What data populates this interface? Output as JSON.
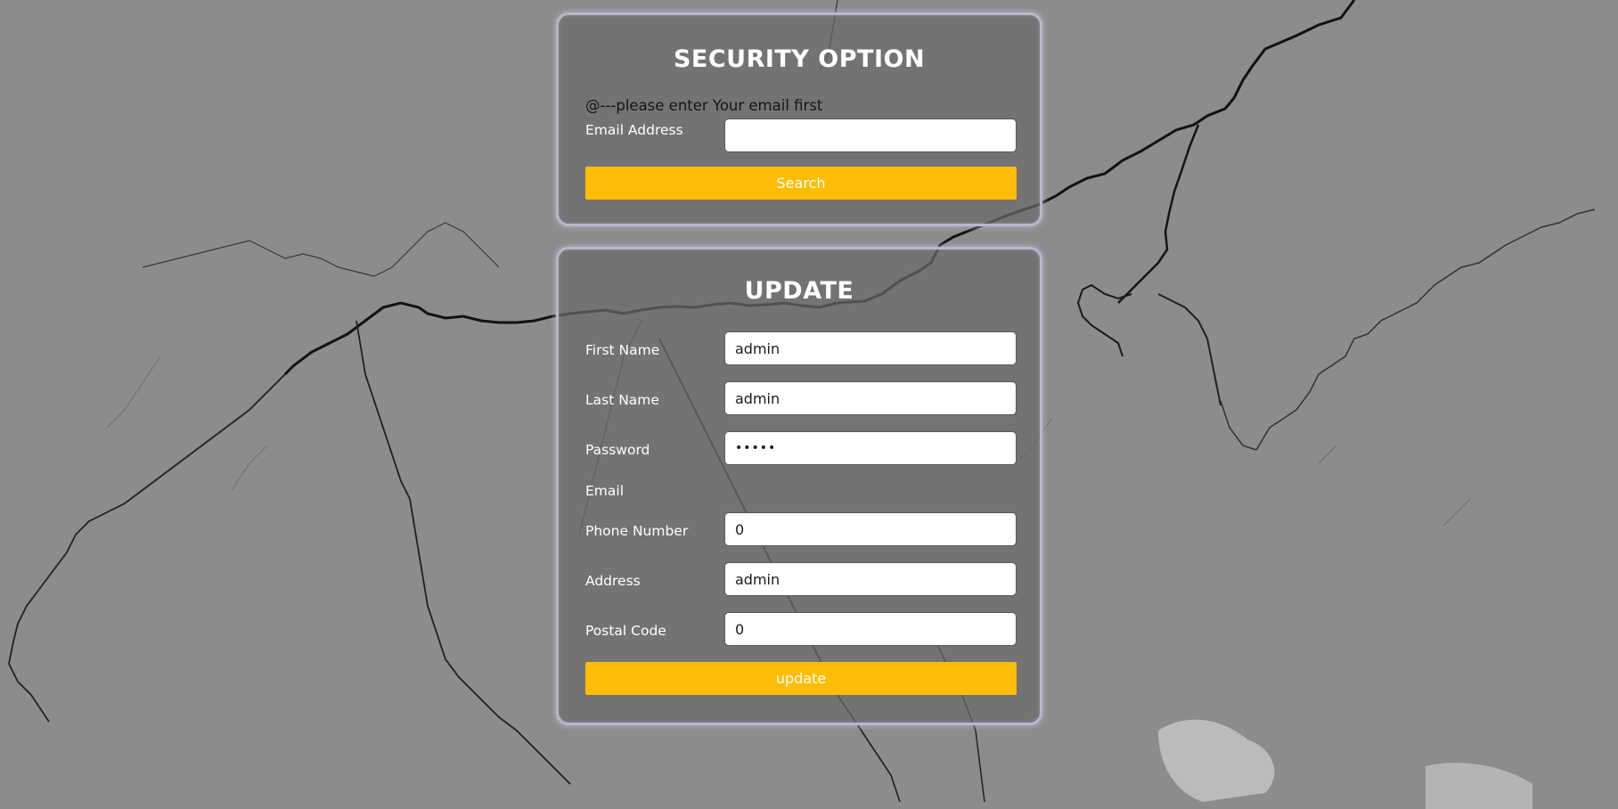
{
  "security": {
    "title": "SECURITY OPTION",
    "hint": "@---please enter Your email first",
    "email_label": "Email Address",
    "email_value": "",
    "search_label": "Search"
  },
  "update": {
    "title": "UPDATE",
    "first_name_label": "First Name",
    "first_name_value": "admin",
    "last_name_label": "Last Name",
    "last_name_value": "admin",
    "password_label": "Password",
    "password_value": "•••••",
    "email_label": "Email",
    "phone_label": "Phone Number",
    "phone_value": "0",
    "address_label": "Address",
    "address_value": "admin",
    "postal_label": "Postal Code",
    "postal_value": "0",
    "update_label": "update"
  },
  "colors": {
    "accent": "#fdbd07",
    "card_border": "#b9b6cc",
    "background": "#8c8c8c"
  }
}
